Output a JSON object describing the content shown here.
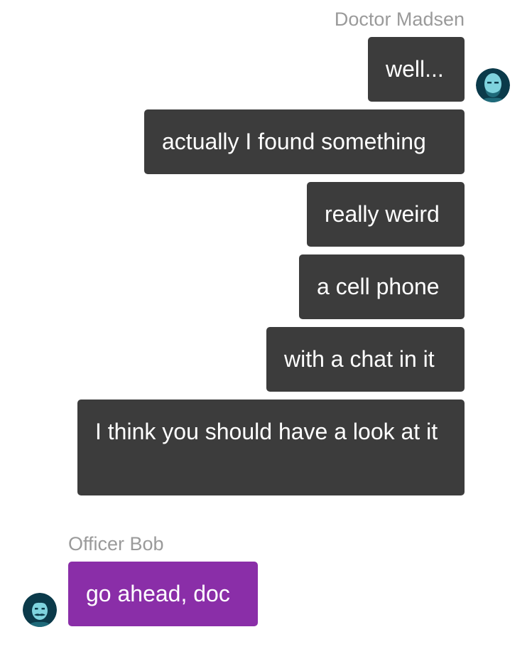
{
  "conversation": {
    "groups": [
      {
        "sender": "Doctor Madsen",
        "direction": "outgoing",
        "avatar_icon": "bald-man-avatar-icon",
        "bubble_color": "#3c3c3c",
        "messages": [
          "well...",
          "actually I found something",
          "really weird",
          "a cell phone",
          "with a chat in it",
          "I think you should have a look at it"
        ]
      },
      {
        "sender": "Officer Bob",
        "direction": "incoming",
        "avatar_icon": "mustached-man-avatar-icon",
        "bubble_color": "#8a2ea8",
        "messages": [
          "go ahead, doc"
        ]
      }
    ]
  },
  "colors": {
    "sender_name": "#9a9a9a",
    "outgoing_bubble": "#3c3c3c",
    "incoming_bubble": "#8a2ea8",
    "bubble_text": "#ffffff",
    "avatar_ring": "#0b3a4a",
    "avatar_skin": "#7fd3de"
  }
}
